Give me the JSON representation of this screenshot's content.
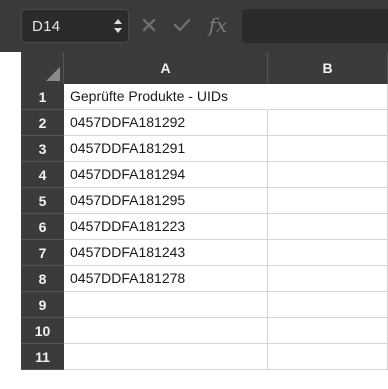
{
  "formula_bar": {
    "name_box_value": "D14",
    "fx_label": "fx",
    "formula_value": ""
  },
  "columns": [
    "A",
    "B"
  ],
  "rows": [
    {
      "index": "1",
      "a": "Geprüfte Produkte - UIDs",
      "b": ""
    },
    {
      "index": "2",
      "a": "0457DDFA181292",
      "b": ""
    },
    {
      "index": "3",
      "a": "0457DDFA181291",
      "b": ""
    },
    {
      "index": "4",
      "a": "0457DDFA181294",
      "b": ""
    },
    {
      "index": "5",
      "a": "0457DDFA181295",
      "b": ""
    },
    {
      "index": "6",
      "a": "0457DDFA181223",
      "b": ""
    },
    {
      "index": "7",
      "a": "0457DDFA181243",
      "b": ""
    },
    {
      "index": "8",
      "a": "0457DDFA181278",
      "b": ""
    },
    {
      "index": "9",
      "a": "",
      "b": ""
    },
    {
      "index": "10",
      "a": "",
      "b": ""
    },
    {
      "index": "11",
      "a": "",
      "b": ""
    }
  ],
  "colors": {
    "toolbar_bg": "#3a3a3c",
    "header_bg": "#3b3b3d",
    "header_text": "#f2f2f2",
    "gridline": "#d4d4d4"
  }
}
